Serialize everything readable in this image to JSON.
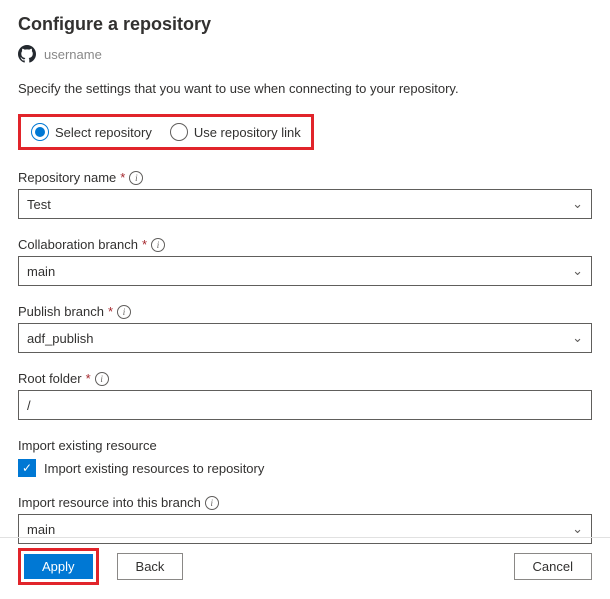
{
  "title": "Configure a repository",
  "owner": "username",
  "description": "Specify the settings that you want to use when connecting to your repository.",
  "modeOptions": {
    "selectRepo": "Select repository",
    "useLink": "Use repository link",
    "selected": "selectRepo"
  },
  "fields": {
    "repoName": {
      "label": "Repository name",
      "value": "Test",
      "required": true,
      "info": true,
      "type": "select"
    },
    "collabBranch": {
      "label": "Collaboration branch",
      "value": "main",
      "required": true,
      "info": true,
      "type": "select"
    },
    "publishBranch": {
      "label": "Publish branch",
      "value": "adf_publish",
      "required": true,
      "info": true,
      "type": "select"
    },
    "rootFolder": {
      "label": "Root folder",
      "value": "/",
      "required": true,
      "info": true,
      "type": "text"
    }
  },
  "importExisting": {
    "header": "Import existing resource",
    "checkbox_label": "Import existing resources to repository",
    "checked": true
  },
  "importBranch": {
    "label": "Import resource into this branch",
    "value": "main",
    "info": true
  },
  "buttons": {
    "apply": "Apply",
    "back": "Back",
    "cancel": "Cancel"
  }
}
